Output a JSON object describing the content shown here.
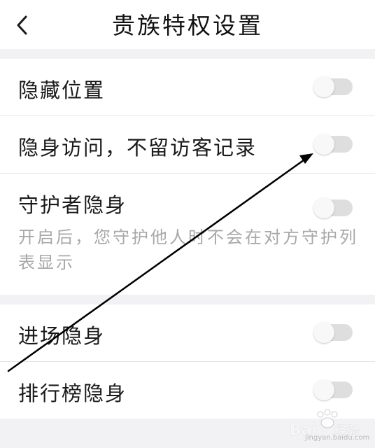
{
  "header": {
    "title": "贵族特权设置",
    "back_icon": "chevron-left-icon"
  },
  "settings": {
    "hide_location": {
      "label": "隐藏位置",
      "enabled": false
    },
    "invisible_visit": {
      "label": "隐身访问，不留访客记录",
      "enabled": false
    },
    "guardian_invisible": {
      "label": "守护者隐身",
      "description": "开启后，您守护他人时不会在对方守护列表显示",
      "enabled": false
    },
    "entrance_invisible": {
      "label": "进场隐身",
      "enabled": false
    },
    "ranking_invisible": {
      "label": "排行榜隐身",
      "enabled": false
    }
  },
  "watermark": {
    "brand": "Bai",
    "brand_suffix": "经验",
    "url": "jingyan.baidu.com"
  },
  "colors": {
    "background": "#f2f2f4",
    "card": "#ffffff",
    "toggle_off_track": "#dedede",
    "description_text": "#a8a8a8",
    "annotation_arrow": "#000000"
  }
}
